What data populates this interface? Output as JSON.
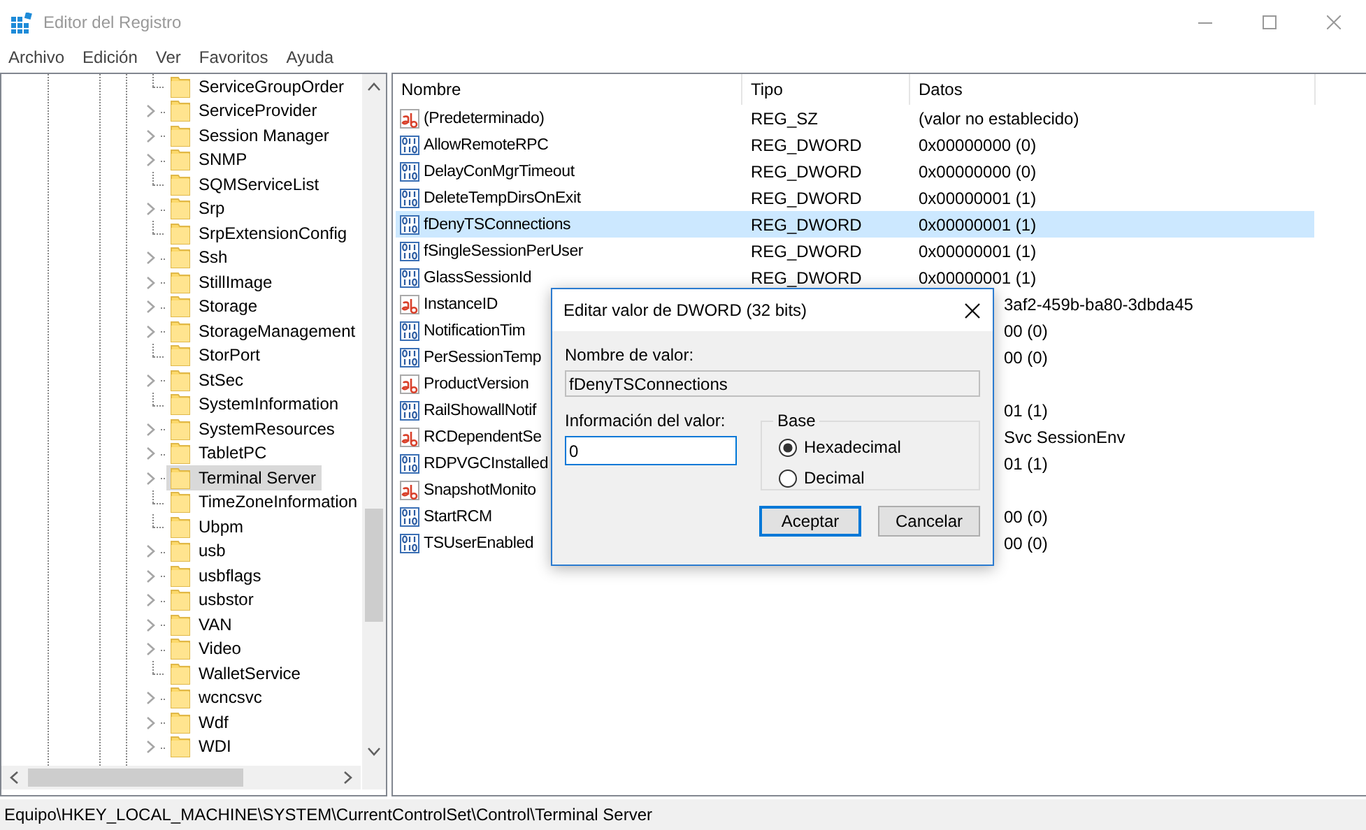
{
  "window": {
    "title": "Editor del Registro"
  },
  "menu": [
    "Archivo",
    "Edición",
    "Ver",
    "Favoritos",
    "Ayuda"
  ],
  "tree": {
    "items": [
      {
        "label": "ServiceGroupOrder",
        "expandable": false,
        "selected": false
      },
      {
        "label": "ServiceProvider",
        "expandable": true,
        "selected": false
      },
      {
        "label": "Session Manager",
        "expandable": true,
        "selected": false
      },
      {
        "label": "SNMP",
        "expandable": true,
        "selected": false
      },
      {
        "label": "SQMServiceList",
        "expandable": false,
        "selected": false
      },
      {
        "label": "Srp",
        "expandable": true,
        "selected": false
      },
      {
        "label": "SrpExtensionConfig",
        "expandable": false,
        "selected": false
      },
      {
        "label": "Ssh",
        "expandable": true,
        "selected": false
      },
      {
        "label": "StillImage",
        "expandable": true,
        "selected": false
      },
      {
        "label": "Storage",
        "expandable": true,
        "selected": false
      },
      {
        "label": "StorageManagement",
        "expandable": true,
        "selected": false
      },
      {
        "label": "StorPort",
        "expandable": false,
        "selected": false
      },
      {
        "label": "StSec",
        "expandable": true,
        "selected": false
      },
      {
        "label": "SystemInformation",
        "expandable": false,
        "selected": false
      },
      {
        "label": "SystemResources",
        "expandable": true,
        "selected": false
      },
      {
        "label": "TabletPC",
        "expandable": true,
        "selected": false
      },
      {
        "label": "Terminal Server",
        "expandable": true,
        "selected": true
      },
      {
        "label": "TimeZoneInformation",
        "expandable": false,
        "selected": false
      },
      {
        "label": "Ubpm",
        "expandable": false,
        "selected": false
      },
      {
        "label": "usb",
        "expandable": true,
        "selected": false
      },
      {
        "label": "usbflags",
        "expandable": true,
        "selected": false
      },
      {
        "label": "usbstor",
        "expandable": true,
        "selected": false
      },
      {
        "label": "VAN",
        "expandable": true,
        "selected": false
      },
      {
        "label": "Video",
        "expandable": true,
        "selected": false
      },
      {
        "label": "WalletService",
        "expandable": false,
        "selected": false
      },
      {
        "label": "wcncsvc",
        "expandable": true,
        "selected": false
      },
      {
        "label": "Wdf",
        "expandable": true,
        "selected": false
      },
      {
        "label": "WDI",
        "expandable": true,
        "selected": false
      }
    ]
  },
  "list": {
    "columns": [
      "Nombre",
      "Tipo",
      "Datos"
    ],
    "rows": [
      {
        "kind": "string",
        "name": "(Predeterminado)",
        "type": "REG_SZ",
        "data": "(valor no establecido)",
        "selected": false
      },
      {
        "kind": "binary",
        "name": "AllowRemoteRPC",
        "type": "REG_DWORD",
        "data": "0x00000000 (0)",
        "selected": false
      },
      {
        "kind": "binary",
        "name": "DelayConMgrTimeout",
        "type": "REG_DWORD",
        "data": "0x00000000 (0)",
        "selected": false
      },
      {
        "kind": "binary",
        "name": "DeleteTempDirsOnExit",
        "type": "REG_DWORD",
        "data": "0x00000001 (1)",
        "selected": false
      },
      {
        "kind": "binary",
        "name": "fDenyTSConnections",
        "type": "REG_DWORD",
        "data": "0x00000001 (1)",
        "selected": true
      },
      {
        "kind": "binary",
        "name": "fSingleSessionPerUser",
        "type": "REG_DWORD",
        "data": "0x00000001 (1)",
        "selected": false
      },
      {
        "kind": "binary",
        "name": "GlassSessionId",
        "type": "REG_DWORD",
        "data": "0x00000001 (1)",
        "selected": false
      },
      {
        "kind": "string",
        "name": "InstanceID",
        "data": "3af2-459b-ba80-3dbda45",
        "selected": false
      },
      {
        "kind": "binary",
        "name": "NotificationTim",
        "data": "00 (0)",
        "selected": false
      },
      {
        "kind": "binary",
        "name": "PerSessionTemp",
        "data": "00 (0)",
        "selected": false
      },
      {
        "kind": "string",
        "name": "ProductVersion",
        "selected": false
      },
      {
        "kind": "binary",
        "name": "RailShowallNotif",
        "data": "01 (1)",
        "selected": false
      },
      {
        "kind": "string",
        "name": "RCDependentSe",
        "data": "Svc SessionEnv",
        "selected": false
      },
      {
        "kind": "binary",
        "name": "RDPVGCInstalled",
        "data": "01 (1)",
        "selected": false
      },
      {
        "kind": "string",
        "name": "SnapshotMonito",
        "selected": false
      },
      {
        "kind": "binary",
        "name": "StartRCM",
        "data": "00 (0)",
        "selected": false
      },
      {
        "kind": "binary",
        "name": "TSUserEnabled",
        "data": "00 (0)",
        "selected": false
      }
    ]
  },
  "dialog": {
    "title": "Editar valor de DWORD (32 bits)",
    "name_label": "Nombre de valor:",
    "name_value": "fDenyTSConnections",
    "data_label": "Información del valor:",
    "data_value": "0",
    "base": {
      "label": "Base",
      "options": [
        {
          "label": "Hexadecimal",
          "selected": true
        },
        {
          "label": "Decimal",
          "selected": false
        }
      ]
    },
    "buttons": [
      {
        "label": "Aceptar",
        "default": true
      },
      {
        "label": "Cancelar",
        "default": false
      }
    ]
  },
  "status_bar": {
    "path": "Equipo\\HKEY_LOCAL_MACHINE\\SYSTEM\\CurrentControlSet\\Control\\Terminal Server"
  }
}
